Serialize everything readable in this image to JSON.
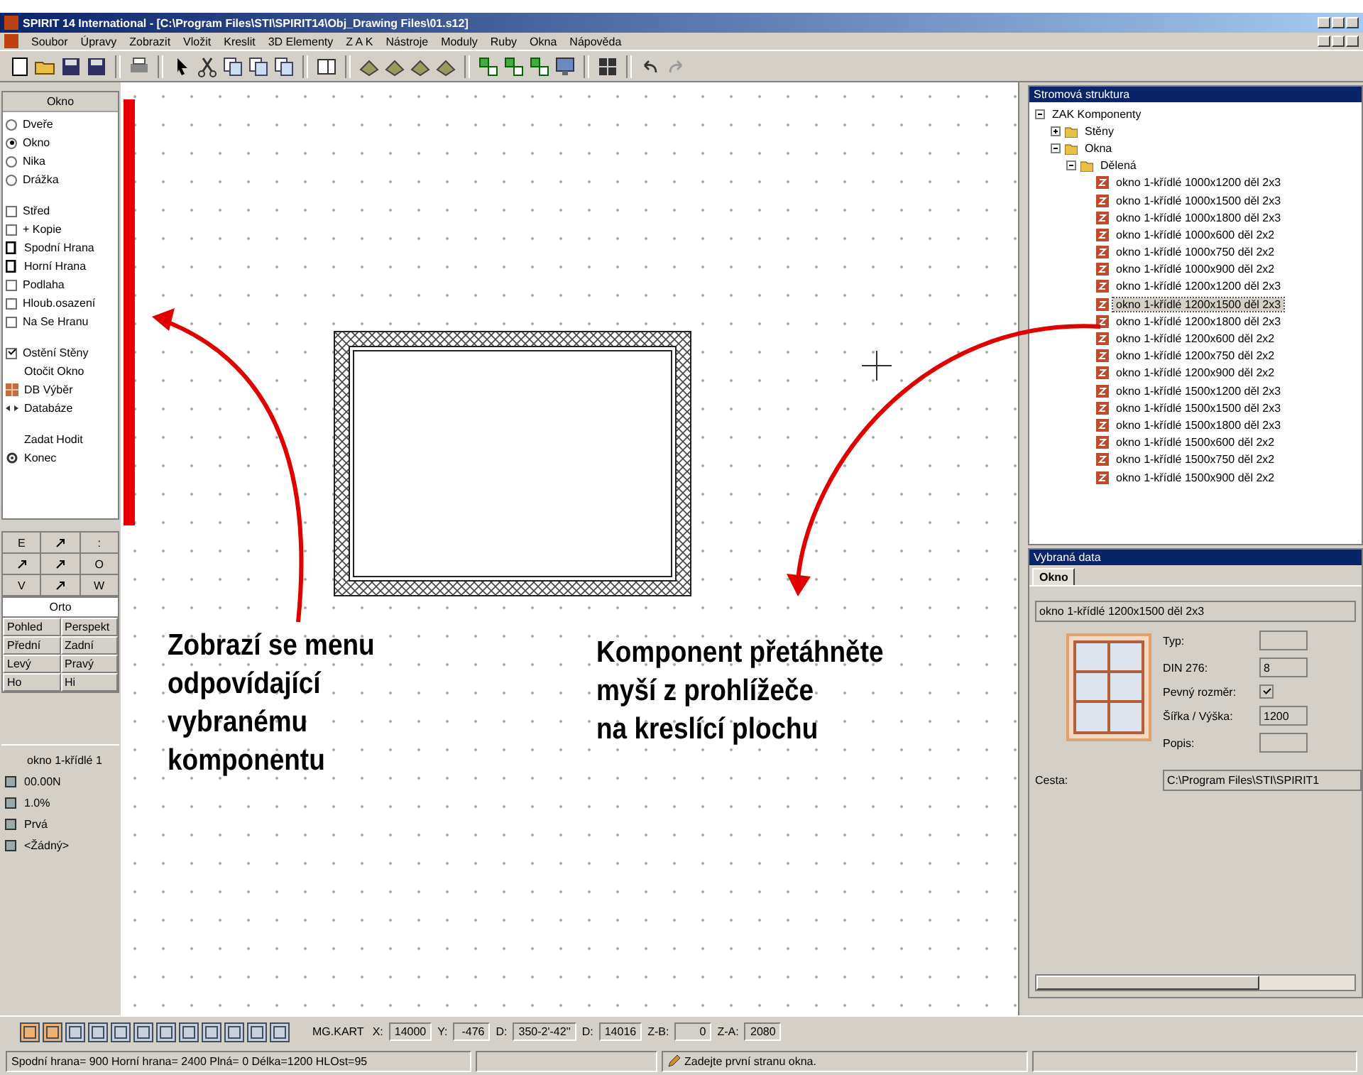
{
  "window": {
    "title": "SPIRIT 14 International - [C:\\Program Files\\STI\\SPIRIT14\\Obj_Drawing Files\\01.s12]"
  },
  "menu": [
    "Soubor",
    "Úpravy",
    "Zobrazit",
    "Vložit",
    "Kreslit",
    "3D Elementy",
    "Z A K",
    "Nástroje",
    "Moduly",
    "Ruby",
    "Okna",
    "Nápověda"
  ],
  "left_panel": {
    "header": "Okno",
    "groups": [
      [
        {
          "kind": "radio",
          "label": "Dveře",
          "selected": false
        },
        {
          "kind": "radio",
          "label": "Okno",
          "selected": true
        },
        {
          "kind": "radio",
          "label": "Nika",
          "selected": false
        },
        {
          "kind": "radio",
          "label": "Drážka",
          "selected": false
        }
      ],
      [
        {
          "kind": "check",
          "label": "Střed",
          "checked": false
        },
        {
          "kind": "check",
          "label": "+ Kopie",
          "checked": false
        },
        {
          "kind": "edge",
          "label": "Spodní Hrana"
        },
        {
          "kind": "edge",
          "label": "Horní Hrana"
        },
        {
          "kind": "check",
          "label": "Podlaha",
          "checked": false
        },
        {
          "kind": "check",
          "label": "Hloub.osazení",
          "checked": false
        },
        {
          "kind": "check",
          "label": "Na Se Hranu",
          "checked": false
        }
      ],
      [
        {
          "kind": "check",
          "label": "Ostění Stěny",
          "checked": true
        },
        {
          "kind": "plain",
          "label": "Otočit Okno"
        },
        {
          "kind": "db",
          "label": "DB Výběr"
        },
        {
          "kind": "arrows",
          "label": "Databáze"
        }
      ],
      [
        {
          "kind": "plain",
          "label": "Zadat Hodit"
        },
        {
          "kind": "exit",
          "label": "Konec"
        }
      ]
    ]
  },
  "nav_pad": [
    {
      "label": "E"
    },
    {
      "kind": "arrow"
    },
    {
      "label": ":"
    },
    {
      "kind": "arrow"
    },
    {
      "kind": "arrow"
    },
    {
      "label": "O"
    },
    {
      "label": "V"
    },
    {
      "kind": "arrow"
    },
    {
      "label": "W"
    }
  ],
  "view_table": {
    "header": "Orto",
    "cells": [
      "Pohled",
      "Perspekt",
      "Přední",
      "Zadní",
      "Levý",
      "Pravý",
      "Ho",
      "Hi"
    ]
  },
  "info_list": [
    {
      "label": "okno 1-křídlé 1"
    },
    {
      "kind": "icon",
      "label": "00.00N"
    },
    {
      "kind": "icon",
      "label": "1.0%"
    },
    {
      "kind": "icon",
      "label": "Prvá"
    },
    {
      "kind": "icon",
      "label": "<Žádný>"
    }
  ],
  "annotations": [
    {
      "lines": [
        "Zobrazí se menu",
        "odpovídající",
        "vybranému",
        "komponentu"
      ]
    },
    {
      "lines": [
        "Komponent přetáhněte",
        "myší z prohlížeče",
        "na kreslící plochu"
      ]
    }
  ],
  "tree": {
    "title": "Stromová struktura",
    "nodes": [
      {
        "label": "ZAK Komponenty",
        "expanded": true,
        "children": [
          {
            "label": "Stěny",
            "expanded": false
          },
          {
            "label": "Okna",
            "expanded": true,
            "children": [
              {
                "label": "Dělená",
                "expanded": true,
                "children": [
                  {
                    "label": "okno 1-křídlé 1000x1200 děl 2x3",
                    "selected": false
                  },
                  {
                    "label": "okno 1-křídlé 1000x1500 děl 2x3",
                    "selected": false
                  },
                  {
                    "label": "okno 1-křídlé 1000x1800 děl 2x3",
                    "selected": false
                  },
                  {
                    "label": "okno 1-křídlé 1000x600 děl 2x2",
                    "selected": false
                  },
                  {
                    "label": "okno 1-křídlé 1000x750 děl 2x2",
                    "selected": false
                  },
                  {
                    "label": "okno 1-křídlé 1000x900 děl 2x2",
                    "selected": false
                  },
                  {
                    "label": "okno 1-křídlé 1200x1200 děl 2x3",
                    "selected": false
                  },
                  {
                    "label": "okno 1-křídlé 1200x1500 děl 2x3",
                    "selected": true
                  },
                  {
                    "label": "okno 1-křídlé 1200x1800 děl 2x3",
                    "selected": false
                  },
                  {
                    "label": "okno 1-křídlé 1200x600 děl 2x2",
                    "selected": false
                  },
                  {
                    "label": "okno 1-křídlé 1200x750 děl 2x2",
                    "selected": false
                  },
                  {
                    "label": "okno 1-křídlé 1200x900 děl 2x2",
                    "selected": false
                  },
                  {
                    "label": "okno 1-křídlé 1500x1200 děl 2x3",
                    "selected": false
                  },
                  {
                    "label": "okno 1-křídlé 1500x1500 děl 2x3",
                    "selected": false
                  },
                  {
                    "label": "okno 1-křídlé 1500x1800 děl 2x3",
                    "selected": false
                  },
                  {
                    "label": "okno 1-křídlé 1500x600 děl 2x2",
                    "selected": false
                  },
                  {
                    "label": "okno 1-křídlé 1500x750 děl 2x2",
                    "selected": false
                  },
                  {
                    "label": "okno 1-křídlé 1500x900 děl 2x2",
                    "selected": false
                  }
                ]
              }
            ]
          }
        ]
      }
    ]
  },
  "properties": {
    "title": "Vybraná data",
    "tabs": [
      {
        "label": "Okno",
        "selected": true
      }
    ],
    "name": "okno 1-křídlé 1200x1500 děl 2x3",
    "fields": [
      {
        "kind": "text",
        "label": "Typ:"
      },
      {
        "kind": "text",
        "label": "DIN 276:",
        "value": "8"
      },
      {
        "kind": "checkbox",
        "label": "Pevný rozměr:",
        "checked": true
      },
      {
        "kind": "text",
        "label": "Šířka / Výška:",
        "value": "1200"
      },
      {
        "kind": "text",
        "label": "Popis:"
      }
    ],
    "path_label": "Cesta:",
    "path": "C:\\Program Files\\STI\\SPIRIT1"
  },
  "coords": [
    {
      "label": "MG.KART"
    },
    {
      "label": "X:",
      "value": "14000"
    },
    {
      "label": "Y:",
      "value": "-476"
    },
    {
      "label": "D:",
      "value": "350-2'-42''"
    },
    {
      "label": "D:",
      "value": "14016"
    },
    {
      "label": "Z-B:",
      "value": "0"
    },
    {
      "label": "Z-A:",
      "value": "2080"
    }
  ],
  "status_bar": {
    "info": "Spodní hrana= 900 Horní hrana= 2400 Plná= 0 Délka=1200 HLOst=95",
    "prompt": "Zadejte první stranu okna."
  }
}
